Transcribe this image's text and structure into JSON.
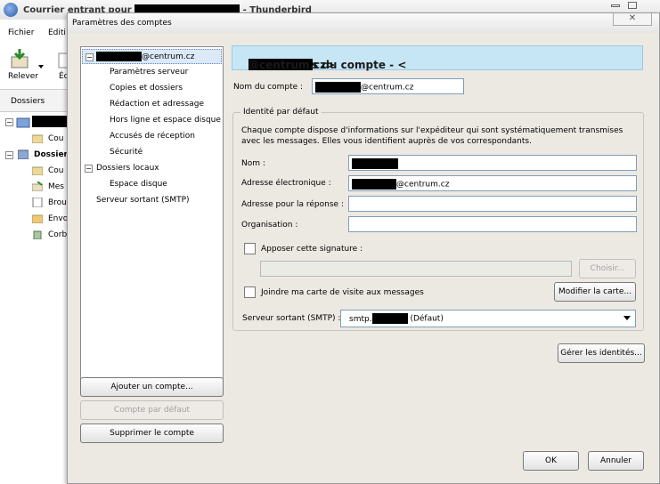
{
  "app": {
    "title_prefix": "Courrier entrant pour",
    "title_suffix": "- Thunderbird",
    "menu": [
      "Fichier",
      "Editi"
    ],
    "toolbar": {
      "get_mail_label": "Relever",
      "second_label": "Éc"
    },
    "tab_label": "Dossiers",
    "folders": [
      "Cou",
      "Dossiers",
      "Cou",
      "Mes",
      "Brou",
      "Envo",
      "Corb"
    ]
  },
  "dialog": {
    "title": "Paramètres des comptes",
    "close_glyph": "✕",
    "tree": {
      "account_suffix": "@centrum.cz",
      "account_items": [
        "Paramètres serveur",
        "Copies et dossiers",
        "Rédaction et adressage",
        "Hors ligne et espace disque",
        "Accusés de réception",
        "Sécurité"
      ],
      "local_folders": "Dossiers locaux",
      "local_items": [
        "Espace disque"
      ],
      "smtp": "Serveur sortant (SMTP)"
    },
    "buttons": {
      "add_account": "Ajouter un compte...",
      "default_account": "Compte par défaut",
      "delete_account": "Supprimer le compte",
      "ok": "OK",
      "cancel": "Annuler"
    },
    "header": {
      "prefix": "Paramètres du compte - <",
      "suffix": "@centrum.cz>"
    },
    "account_name": {
      "label": "Nom du compte :",
      "value_suffix": "@centrum.cz"
    },
    "identity": {
      "legend": "Identité par défaut",
      "description": "Chaque compte dispose d'informations sur l'expéditeur qui sont systématiquement transmises avec les messages. Elles vous identifient auprès de vos correspondants.",
      "name_label": "Nom :",
      "email_label": "Adresse électronique :",
      "email_suffix": "@centrum.cz",
      "reply_label": "Adresse pour la réponse :",
      "reply_value": "",
      "org_label": "Organisation :",
      "org_value": "",
      "signature_label": "Apposer cette signature :",
      "signature_path": "",
      "choose_button": "Choisir...",
      "vcard_label": "Joindre ma carte de visite aux messages",
      "edit_card_button": "Modifier la carte...",
      "smtp_label": "Serveur sortant (SMTP) :",
      "smtp_prefix": "smtp.",
      "smtp_suffix": "(Défaut)"
    },
    "manage_identities": "Gérer les identités..."
  }
}
